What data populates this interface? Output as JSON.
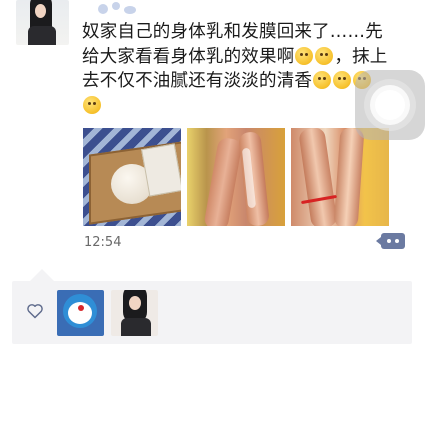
{
  "post": {
    "text_lines": [
      "奴家自己的身体乳和发膜回来了……先",
      "给大家看看身体乳的效果啊",
      "，抹上",
      "去不仅不油腻还有淡淡的清香"
    ],
    "timestamp": "12:54",
    "emoji_names": [
      "shy-smile-emoji",
      "shy-smile-emoji",
      "thinking-emoji",
      "thinking-emoji",
      "smile-emoji"
    ],
    "photos": [
      "product-photo",
      "legs-photo-1",
      "legs-photo-2"
    ]
  },
  "likes": {
    "icon": "heart-outline-icon",
    "avatars": [
      "doraemon-avatar",
      "girl-avatar"
    ]
  }
}
